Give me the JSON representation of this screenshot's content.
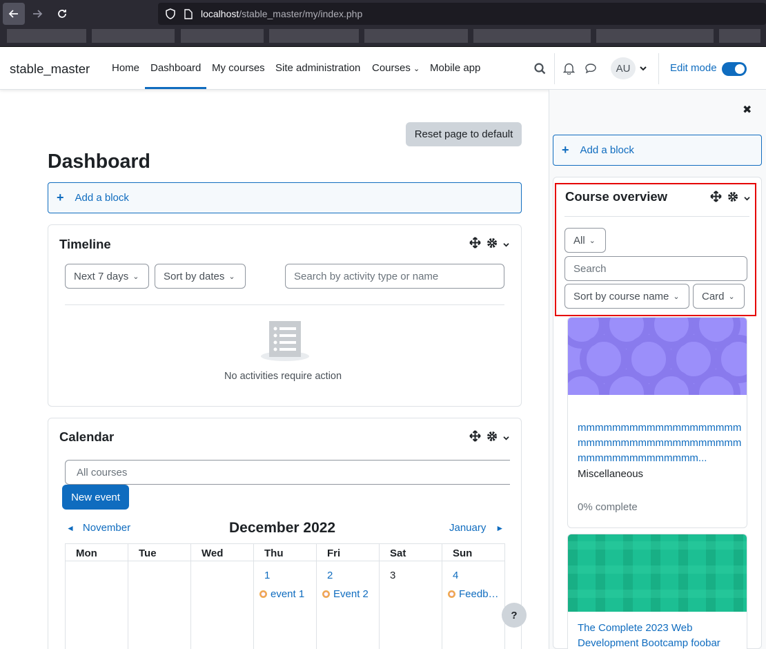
{
  "browser": {
    "url_host": "localhost",
    "url_path": "/stable_master/my/index.php"
  },
  "navbar": {
    "brand": "stable_master",
    "links": [
      "Home",
      "Dashboard",
      "My courses",
      "Site administration",
      "Courses",
      "Mobile app"
    ],
    "active": "Dashboard",
    "avatar_initials": "AU",
    "edit_mode_label": "Edit mode",
    "edit_mode_on": true
  },
  "main": {
    "reset_label": "Reset page to default",
    "title": "Dashboard",
    "add_block_label": "Add a block",
    "timeline": {
      "title": "Timeline",
      "range_select": "Next 7 days",
      "sort_select": "Sort by dates",
      "search_placeholder": "Search by activity type or name",
      "empty_message": "No activities require action"
    },
    "calendar": {
      "title": "Calendar",
      "course_select": "All courses",
      "new_event_label": "New event",
      "prev_month": "November",
      "current_month": "December 2022",
      "next_month": "January",
      "weekdays": [
        "Mon",
        "Tue",
        "Wed",
        "Thu",
        "Fri",
        "Sat",
        "Sun"
      ],
      "days": [
        {
          "num": "1",
          "event": "event 1"
        },
        {
          "num": "2",
          "event": "Event 2"
        },
        {
          "num": "3",
          "event": ""
        },
        {
          "num": "4",
          "event": "Feedb…"
        }
      ]
    },
    "help_label": "?"
  },
  "drawer": {
    "add_block_label": "Add a block",
    "course_overview": {
      "title": "Course overview",
      "filter_select": "All",
      "search_placeholder": "Search",
      "sort_select": "Sort by course name",
      "view_select": "Card",
      "courses": [
        {
          "name": "mmmmmmmmmmmmmmmmmmmmmmmmmmmmmmmmmmmmmmmmmmmmmmmmmmmm...",
          "category": "Miscellaneous",
          "progress": "0% complete",
          "image_color": "#9b8ffa"
        },
        {
          "name": "The Complete 2023 Web Development Bootcamp foobar",
          "image_color": "#1cbf93"
        }
      ]
    }
  },
  "colors": {
    "primary": "#0f6cbf",
    "highlight": "#e60000"
  }
}
